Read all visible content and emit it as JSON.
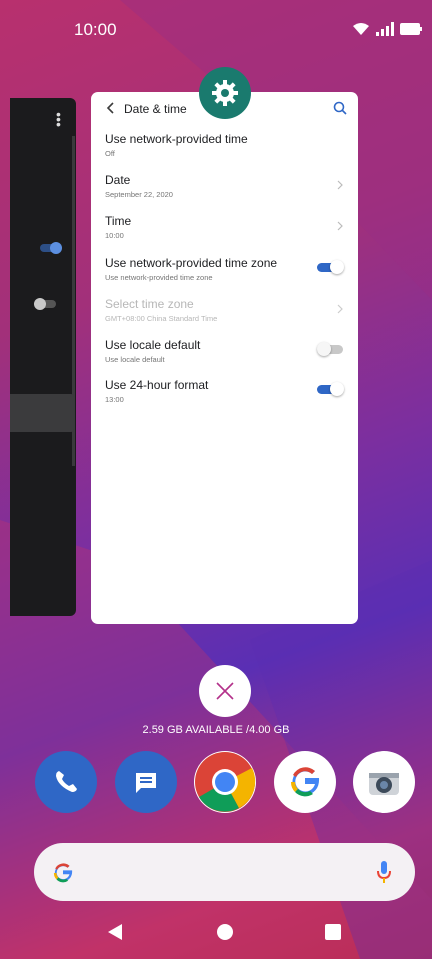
{
  "status_bar": {
    "time": "10:00",
    "icons": [
      "wifi-icon",
      "signal-icon",
      "battery-icon"
    ]
  },
  "recent_app": {
    "icon": "settings-gear-icon",
    "header": {
      "title": "Date & time",
      "back_icon": "back-chevron-icon",
      "search_icon": "search-icon"
    },
    "rows": [
      {
        "title": "Use network-provided time",
        "subtitle": "Off",
        "control": "none",
        "enabled": true
      },
      {
        "title": "Date",
        "subtitle": "September 22, 2020",
        "control": "chevron",
        "enabled": true
      },
      {
        "title": "Time",
        "subtitle": "10:00",
        "control": "chevron",
        "enabled": true
      },
      {
        "title": "Use network-provided time zone",
        "subtitle": "Use network-provided time zone",
        "control": "toggle",
        "checked": true,
        "enabled": true
      },
      {
        "title": "Select time zone",
        "subtitle": "GMT+08:00 China Standard Time",
        "control": "chevron",
        "enabled": false
      },
      {
        "title": "Use locale default",
        "subtitle": "Use locale default",
        "control": "toggle",
        "checked": false,
        "enabled": true
      },
      {
        "title": "Use 24-hour format",
        "subtitle": "13:00",
        "control": "toggle",
        "checked": true,
        "enabled": true
      }
    ]
  },
  "recents": {
    "close_all_icon": "close-icon",
    "memory_text": "2.59 GB AVAILABLE /4.00 GB"
  },
  "dock": [
    {
      "name": "phone-app",
      "icon": "phone-icon",
      "color": "#2f67c6"
    },
    {
      "name": "messages-app",
      "icon": "message-icon",
      "color": "#2f67c6"
    },
    {
      "name": "chrome-app",
      "icon": "chrome-icon",
      "color": "#ffffff"
    },
    {
      "name": "google-app",
      "icon": "google-g-icon",
      "color": "#ffffff"
    },
    {
      "name": "camera-app",
      "icon": "camera-icon",
      "color": "#ffffff"
    }
  ],
  "search_bar": {
    "left_icon": "google-g-icon",
    "right_icon": "microphone-icon"
  },
  "nav": {
    "back": "back-triangle-icon",
    "home": "home-circle-icon",
    "recents": "recents-square-icon"
  },
  "colors": {
    "accent": "#2f67c6",
    "settings_badge": "#1a7a6e"
  }
}
